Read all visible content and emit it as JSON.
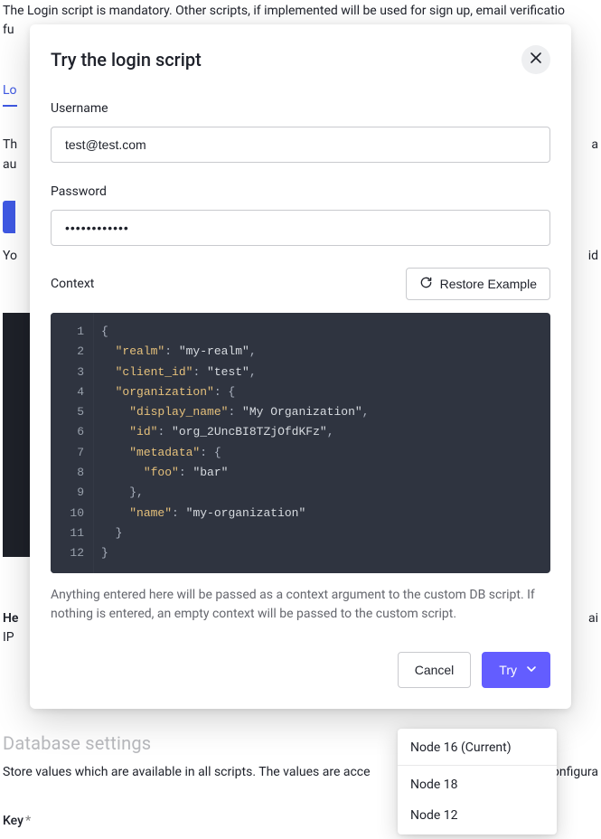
{
  "backdrop": {
    "top_line": "The Login script is mandatory. Other scripts, if implemented will be used for sign up, email verificatio",
    "top_line2": "fu",
    "tab": "Lo",
    "th": "Th",
    "au": "au",
    "yo": "Yo",
    "h": "He",
    "ip": "IP",
    "heading2_masked": "Database settings",
    "store_text": "Store values which are available in all scripts. The values are acce",
    "store_tail": "ai",
    "config_tail": "configura",
    "key_label": "Key",
    "id_tail": "id"
  },
  "modal": {
    "title": "Try the login script",
    "close_icon": "✕",
    "username_label": "Username",
    "username_value": "test@test.com",
    "password_label": "Password",
    "password_value": "••••••••••••",
    "context_label": "Context",
    "restore_label": "Restore Example",
    "helper": "Anything entered here will be passed as a context argument to the custom DB script. If nothing is entered, an empty context will be passed to the custom script.",
    "cancel": "Cancel",
    "try": "Try"
  },
  "code": {
    "lines": [
      [
        {
          "t": "punc",
          "v": "{"
        }
      ],
      [
        {
          "t": "sp",
          "v": "  "
        },
        {
          "t": "key",
          "v": "\"realm\""
        },
        {
          "t": "punc",
          "v": ": "
        },
        {
          "t": "str",
          "v": "\"my-realm\""
        },
        {
          "t": "punc",
          "v": ","
        }
      ],
      [
        {
          "t": "sp",
          "v": "  "
        },
        {
          "t": "key",
          "v": "\"client_id\""
        },
        {
          "t": "punc",
          "v": ": "
        },
        {
          "t": "str",
          "v": "\"test\""
        },
        {
          "t": "punc",
          "v": ","
        }
      ],
      [
        {
          "t": "sp",
          "v": "  "
        },
        {
          "t": "key",
          "v": "\"organization\""
        },
        {
          "t": "punc",
          "v": ": {"
        }
      ],
      [
        {
          "t": "sp",
          "v": "    "
        },
        {
          "t": "key",
          "v": "\"display_name\""
        },
        {
          "t": "punc",
          "v": ": "
        },
        {
          "t": "str",
          "v": "\"My Organization\""
        },
        {
          "t": "punc",
          "v": ","
        }
      ],
      [
        {
          "t": "sp",
          "v": "    "
        },
        {
          "t": "key",
          "v": "\"id\""
        },
        {
          "t": "punc",
          "v": ": "
        },
        {
          "t": "str",
          "v": "\"org_2UncBI8TZjOfdKFz\""
        },
        {
          "t": "punc",
          "v": ","
        }
      ],
      [
        {
          "t": "sp",
          "v": "    "
        },
        {
          "t": "key",
          "v": "\"metadata\""
        },
        {
          "t": "punc",
          "v": ": {"
        }
      ],
      [
        {
          "t": "sp",
          "v": "      "
        },
        {
          "t": "key",
          "v": "\"foo\""
        },
        {
          "t": "punc",
          "v": ": "
        },
        {
          "t": "str",
          "v": "\"bar\""
        }
      ],
      [
        {
          "t": "sp",
          "v": "    "
        },
        {
          "t": "punc",
          "v": "},"
        }
      ],
      [
        {
          "t": "sp",
          "v": "    "
        },
        {
          "t": "key",
          "v": "\"name\""
        },
        {
          "t": "punc",
          "v": ": "
        },
        {
          "t": "str",
          "v": "\"my-organization\""
        }
      ],
      [
        {
          "t": "sp",
          "v": "  "
        },
        {
          "t": "punc",
          "v": "}"
        }
      ],
      [
        {
          "t": "punc",
          "v": "}"
        }
      ]
    ]
  },
  "dropdown": {
    "items": [
      {
        "label": "Node 16 (Current)",
        "current": true
      },
      {
        "label": "Node 18",
        "current": false
      },
      {
        "label": "Node 12",
        "current": false
      }
    ]
  }
}
